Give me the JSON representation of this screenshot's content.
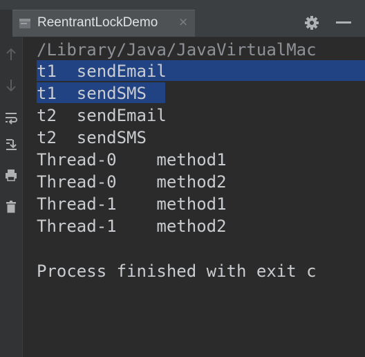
{
  "tab": {
    "title": "ReentrantLockDemo",
    "close_glyph": "×"
  },
  "toolbar": {
    "settings_icon": "gear-icon",
    "minimize_icon": "minimize-icon",
    "side_icons": [
      "arrow-up-icon",
      "arrow-down-icon",
      "soft-wrap-icon",
      "scroll-to-end-icon",
      "print-icon",
      "trash-icon"
    ]
  },
  "console": {
    "lines": [
      "/Library/Java/JavaVirtualMac",
      "t1  sendEmail",
      "t1  sendSMS",
      "t2  sendEmail",
      "t2  sendSMS",
      "Thread-0    method1",
      "Thread-0    method2",
      "Thread-1    method1",
      "Thread-1    method2",
      "",
      "Process finished with exit c"
    ],
    "selected_lines": [
      1,
      2
    ]
  },
  "colors": {
    "background": "#2b2b2b",
    "text": "#c9ccd0",
    "selection": "#214283",
    "tab_active": "#4e5254"
  }
}
